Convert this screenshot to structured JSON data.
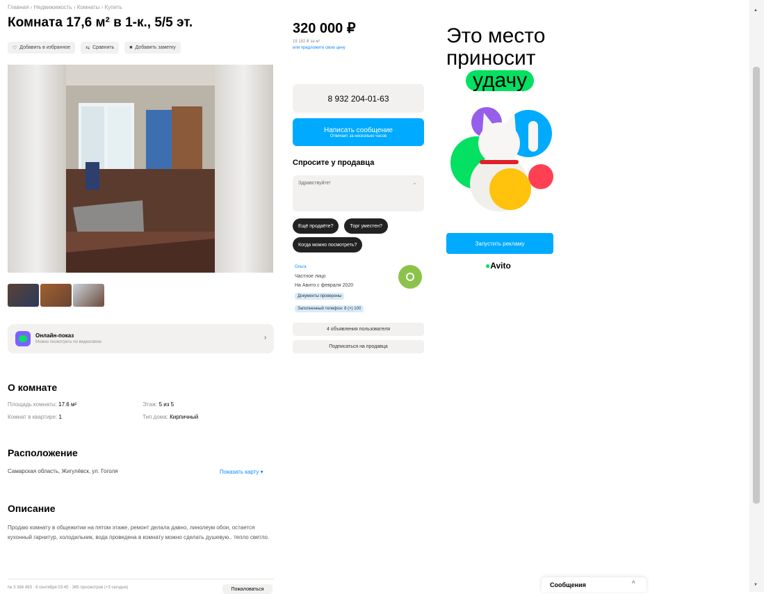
{
  "breadcrumb": "Главная › Недвижимость › Комнаты › Купить",
  "listing": {
    "title": "Комната 17,6 м² в 1-к., 5/5 эт.",
    "actions": [
      "Добавить в избранное",
      "Сравнить",
      "Добавить заметку"
    ],
    "online_view": {
      "title": "Онлайн-показ",
      "subtitle": "Можно посмотреть по видеосвязи"
    },
    "about_heading": "О комнате",
    "params": [
      {
        "label": "Площадь комнаты:",
        "value": "17.6 м²"
      },
      {
        "label": "Этаж:",
        "value": "5 из 5"
      },
      {
        "label": "Комнат в квартире:",
        "value": "1"
      },
      {
        "label": "Тип дома:",
        "value": "Кирпичный"
      }
    ],
    "location_heading": "Расположение",
    "address": "Самарская область, Жигулёвск, ул. Гоголя",
    "show_map": "Показать карту",
    "description_heading": "Описание",
    "description": "Продаю комнату в общежитии на пятом этаже, ремонт делала давно, линолеум обои, остается кухонный гарнитур, холодильник, вода проведена в комнату можно сделать душевую.. тепло светло.",
    "footer_meta": "№ 3 384 493 · 6 сентября 03:45 · 365 просмотров (+3 сегодня)",
    "footer_button": "Пожаловаться"
  },
  "sidebar": {
    "price": "320 000 ₽",
    "price_per_m": "18 182 ₽ за м²",
    "price_history": "или предложите свою цену",
    "phone": "8 932 204-01-63",
    "message_button": "Написать сообщение",
    "message_sub": "Отвечает за несколько часов",
    "ask_heading": "Спросите у продавца",
    "ask_placeholder": "Здравствуйте!",
    "quick_questions": [
      "Ещё продаёте?",
      "Торг уместен?",
      "Когда можно посмотреть?"
    ],
    "seller_name": "Ольга",
    "seller_type": "Частное лицо",
    "seller_since": "На Авито с февраля 2020",
    "badges": [
      "Документы проверены",
      "Заполненный телефон: 8 (×) 100"
    ],
    "other_ads": "4 объявления пользователя",
    "subscribe": "Подписаться на продавца"
  },
  "ad": {
    "line1": "Это место",
    "line2": "приносит",
    "line3": "удачу",
    "button": "Запустить рекламу",
    "brand": "Avito"
  },
  "messenger": {
    "label": "Сообщения"
  },
  "colors": {
    "accent": "#00aaff",
    "green": "#04e061",
    "seller_avatar": "#8bc34a"
  }
}
